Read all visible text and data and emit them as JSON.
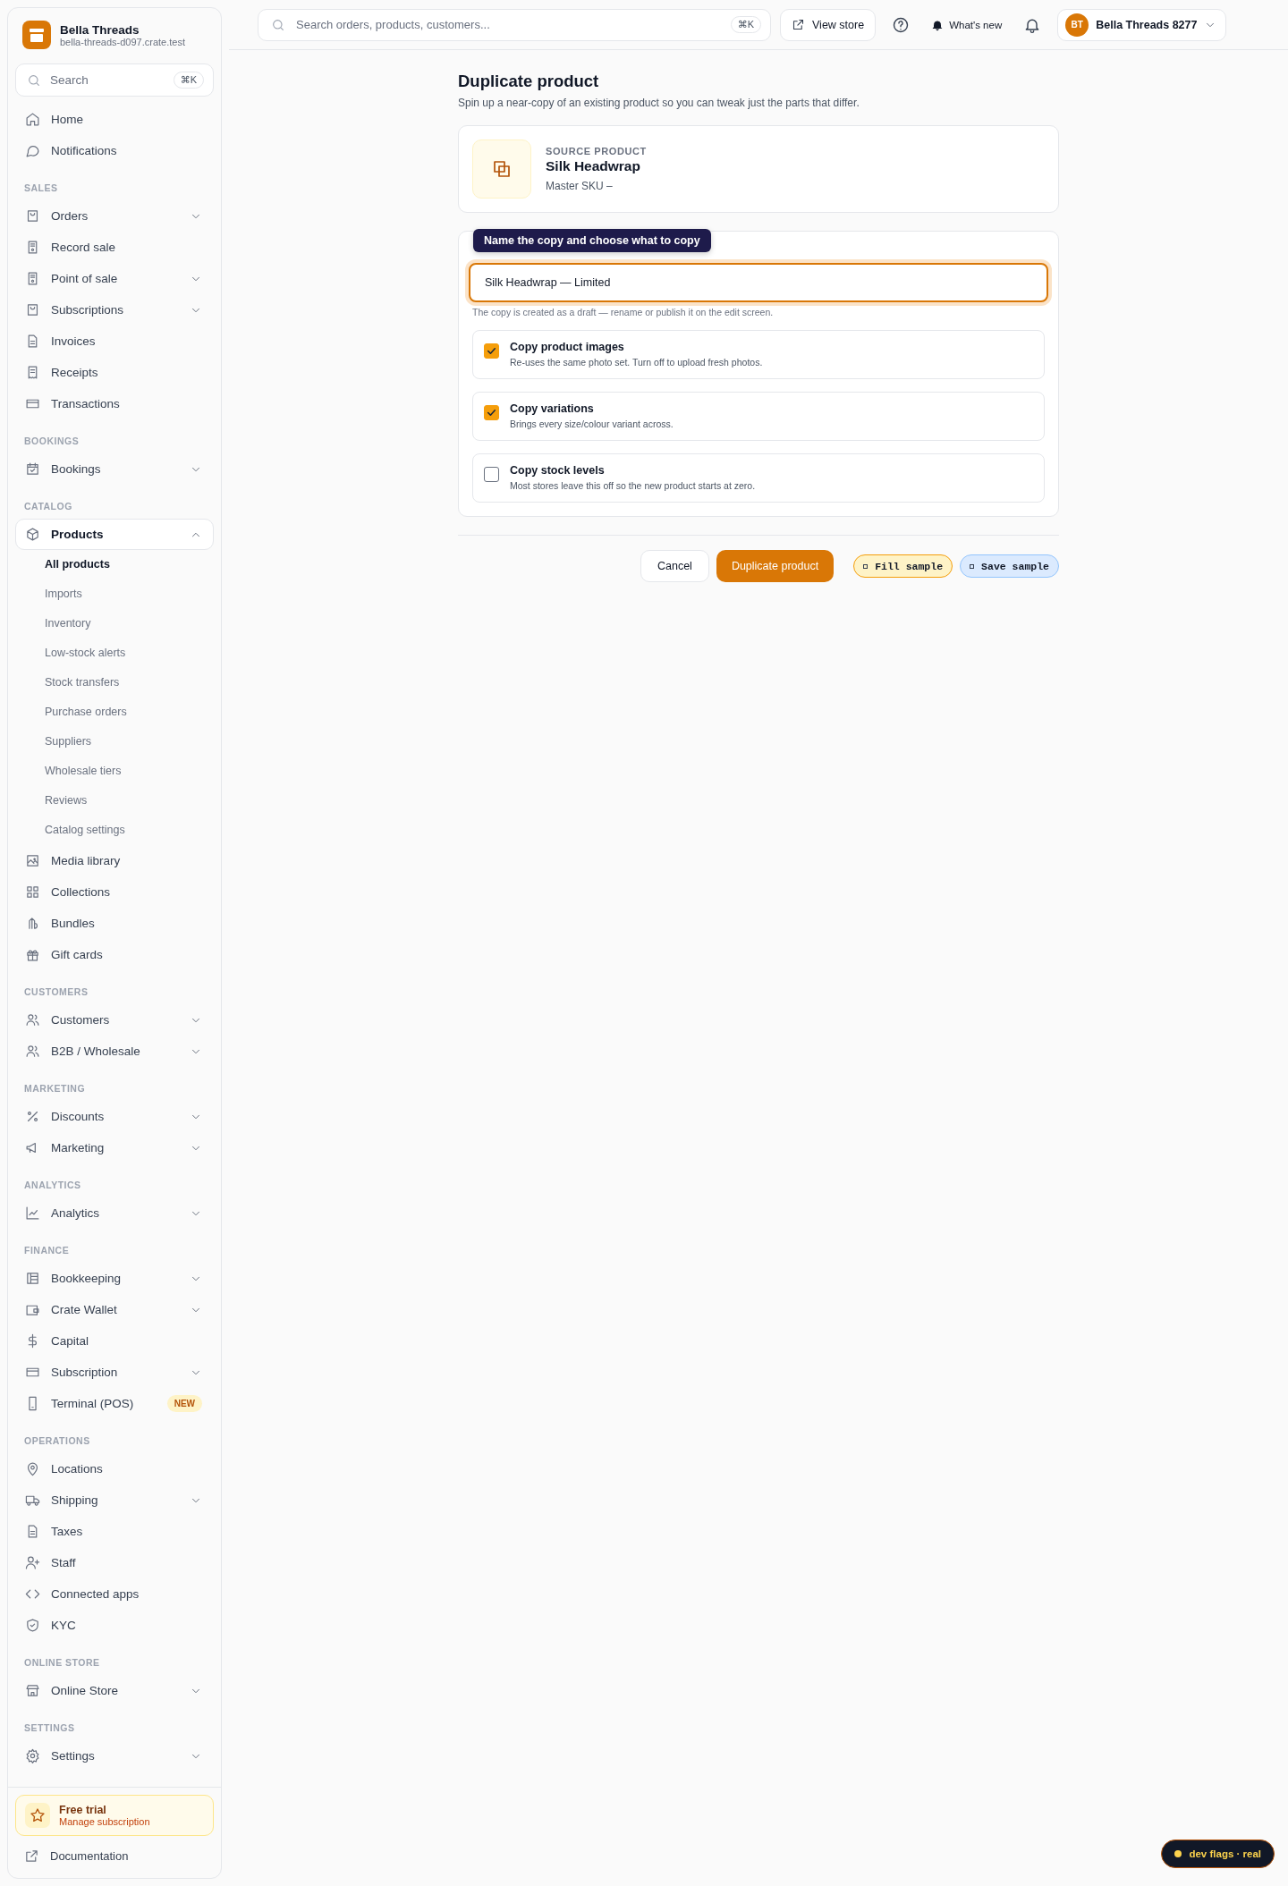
{
  "workspace": {
    "name": "Bella Threads",
    "domain": "bella-threads-d097.crate.test"
  },
  "sidebar_search": {
    "placeholder": "Search",
    "shortcut": "⌘K"
  },
  "sidebar": [
    {
      "items": [
        {
          "label": "Home",
          "selected": false,
          "expandable": false,
          "expanded": false
        },
        {
          "label": "Notifications",
          "selected": false,
          "expandable": false,
          "expanded": false
        }
      ]
    },
    {
      "heading": "SALES",
      "items": [
        {
          "label": "Orders",
          "selected": false,
          "expandable": true,
          "expanded": false
        },
        {
          "label": "Record sale",
          "selected": false,
          "expandable": false,
          "expanded": false
        },
        {
          "label": "Point of sale",
          "selected": false,
          "expandable": true,
          "expanded": false
        },
        {
          "label": "Subscriptions",
          "selected": false,
          "expandable": true,
          "expanded": false
        },
        {
          "label": "Invoices",
          "selected": false,
          "expandable": false,
          "expanded": false
        },
        {
          "label": "Receipts",
          "selected": false,
          "expandable": false,
          "expanded": false
        },
        {
          "label": "Transactions",
          "selected": false,
          "expandable": false,
          "expanded": false
        }
      ]
    },
    {
      "heading": "BOOKINGS",
      "items": [
        {
          "label": "Bookings",
          "selected": false,
          "expandable": true,
          "expanded": false
        }
      ]
    },
    {
      "heading": "CATALOG",
      "items": [
        {
          "label": "Products",
          "selected": true,
          "expandable": true,
          "expanded": true,
          "children": [
            {
              "label": "All products",
              "selected": true
            },
            {
              "label": "Imports",
              "selected": false
            },
            {
              "label": "Inventory",
              "selected": false
            },
            {
              "label": "Low-stock alerts",
              "selected": false
            },
            {
              "label": "Stock transfers",
              "selected": false
            },
            {
              "label": "Purchase orders",
              "selected": false
            },
            {
              "label": "Suppliers",
              "selected": false
            },
            {
              "label": "Wholesale tiers",
              "selected": false
            },
            {
              "label": "Reviews",
              "selected": false
            },
            {
              "label": "Catalog settings",
              "selected": false
            }
          ]
        },
        {
          "label": "Media library",
          "selected": false,
          "expandable": false,
          "expanded": false
        },
        {
          "label": "Collections",
          "selected": false,
          "expandable": false,
          "expanded": false
        },
        {
          "label": "Bundles",
          "selected": false,
          "expandable": false,
          "expanded": false
        },
        {
          "label": "Gift cards",
          "selected": false,
          "expandable": false,
          "expanded": false
        }
      ]
    },
    {
      "heading": "CUSTOMERS",
      "items": [
        {
          "label": "Customers",
          "selected": false,
          "expandable": true,
          "expanded": false
        },
        {
          "label": "B2B / Wholesale",
          "selected": false,
          "expandable": true,
          "expanded": false
        }
      ]
    },
    {
      "heading": "MARKETING",
      "items": [
        {
          "label": "Discounts",
          "selected": false,
          "expandable": true,
          "expanded": false
        },
        {
          "label": "Marketing",
          "selected": false,
          "expandable": true,
          "expanded": false
        }
      ]
    },
    {
      "heading": "ANALYTICS",
      "items": [
        {
          "label": "Analytics",
          "selected": false,
          "expandable": true,
          "expanded": false
        }
      ]
    },
    {
      "heading": "FINANCE",
      "items": [
        {
          "label": "Bookkeeping",
          "selected": false,
          "expandable": true,
          "expanded": false
        },
        {
          "label": "Crate Wallet",
          "selected": false,
          "expandable": true,
          "expanded": false
        },
        {
          "label": "Capital",
          "selected": false,
          "expandable": false,
          "expanded": false
        },
        {
          "label": "Subscription",
          "selected": false,
          "expandable": true,
          "expanded": false
        },
        {
          "label": "Terminal (POS)",
          "selected": false,
          "expandable": false,
          "expanded": false,
          "badge": "NEW"
        }
      ]
    },
    {
      "heading": "OPERATIONS",
      "items": [
        {
          "label": "Locations",
          "selected": false,
          "expandable": false,
          "expanded": false
        },
        {
          "label": "Shipping",
          "selected": false,
          "expandable": true,
          "expanded": false
        },
        {
          "label": "Taxes",
          "selected": false,
          "expandable": false,
          "expanded": false
        },
        {
          "label": "Staff",
          "selected": false,
          "expandable": false,
          "expanded": false
        },
        {
          "label": "Connected apps",
          "selected": false,
          "expandable": false,
          "expanded": false
        },
        {
          "label": "KYC",
          "selected": false,
          "expandable": false,
          "expanded": false
        }
      ]
    },
    {
      "heading": "ONLINE STORE",
      "items": [
        {
          "label": "Online Store",
          "selected": false,
          "expandable": true,
          "expanded": false
        }
      ]
    },
    {
      "heading": "SETTINGS",
      "items": [
        {
          "label": "Settings",
          "selected": false,
          "expandable": true,
          "expanded": false
        }
      ]
    }
  ],
  "trial": {
    "title": "Free trial",
    "subtitle": "Manage subscription"
  },
  "documentation": "Documentation",
  "topbar": {
    "search": {
      "placeholder": "Search orders, products, customers...",
      "shortcut": "⌘K"
    },
    "view_store": "View store",
    "whats_new": "What's new",
    "account": {
      "initials": "BT",
      "name": "Bella Threads 8277"
    }
  },
  "page": {
    "title": "Duplicate product",
    "subtitle": "Spin up a near-copy of an existing product so you can tweak just the parts that differ.",
    "source": {
      "label": "SOURCE PRODUCT",
      "name": "Silk Headwrap",
      "sku": "Master SKU –"
    },
    "form": {
      "tooltip": "Name the copy and choose what to copy",
      "name_value": "Silk Headwrap — Limited",
      "help": "The copy is created as a draft — rename or publish it on the edit screen.",
      "options": [
        {
          "title": "Copy product images",
          "description": "Re-uses the same photo set. Turn off to upload fresh photos.",
          "checked": true
        },
        {
          "title": "Copy variations",
          "description": "Brings every size/colour variant across.",
          "checked": true
        },
        {
          "title": "Copy stock levels",
          "description": "Most stores leave this off so the new product starts at zero.",
          "checked": false
        }
      ]
    },
    "actions": {
      "cancel": "Cancel",
      "primary": "Duplicate product"
    },
    "dev_buttons": [
      {
        "label": "Fill sample",
        "color": "#fef3c7"
      },
      {
        "label": "Save sample",
        "color": "#dbeafe"
      }
    ]
  },
  "dev_flags": "dev flags · real"
}
